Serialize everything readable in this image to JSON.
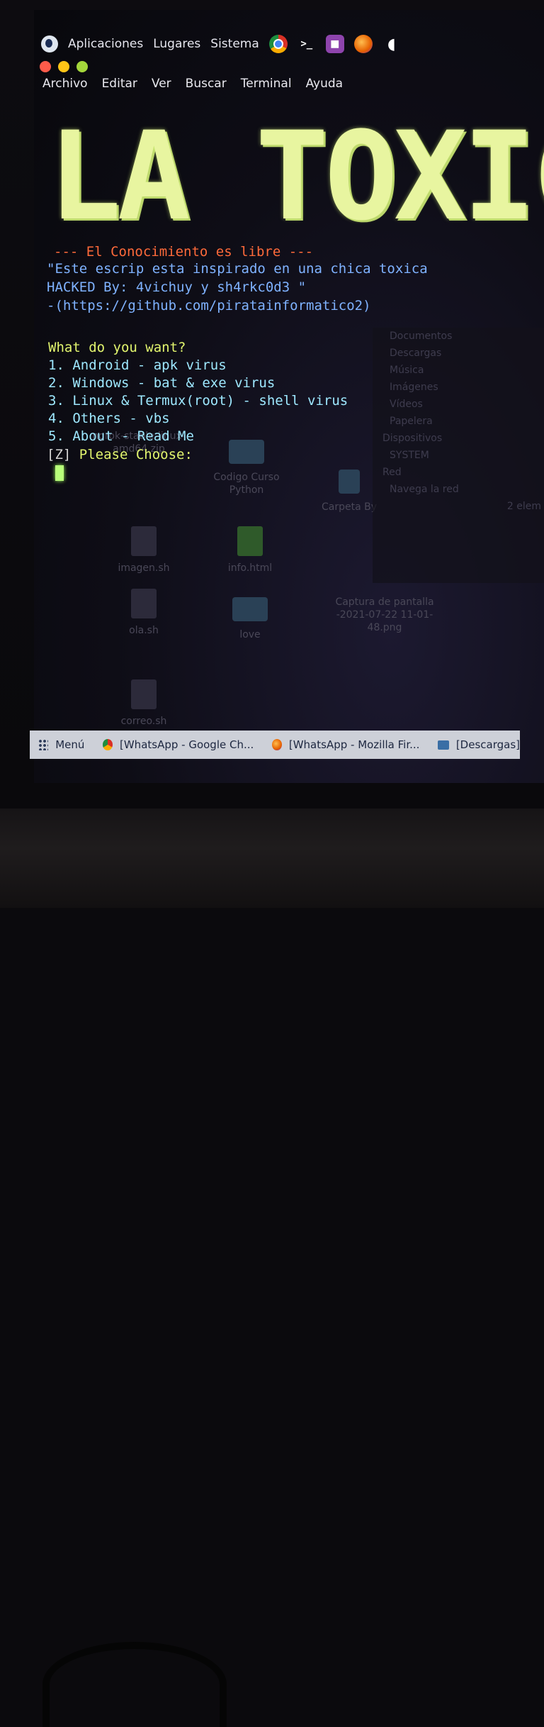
{
  "top_panel": {
    "applications": "Aplicaciones",
    "places": "Lugares",
    "system": "Sistema",
    "launchers": [
      "chrome-icon",
      "terminal-icon",
      "purple-app-icon",
      "firefox-icon",
      "moon-icon"
    ],
    "terminal_glyph": ">_"
  },
  "window_controls": {
    "close_color": "#ff5b4a",
    "minimize_color": "#ffc517",
    "maximize_color": "#a4d63b"
  },
  "menubar": {
    "items": [
      "Archivo",
      "Editar",
      "Ver",
      "Buscar",
      "Terminal",
      "Ayuda"
    ]
  },
  "terminal": {
    "banner": "LA TOXICA",
    "tagline": "--- El Conocimiento es libre ---",
    "quote_line1": "\"Este escrip esta inspirado en una chica toxica",
    "quote_line2": " HACKED By: 4vichuy y sh4rkc0d3 \"",
    "url_line": " -(https://github.com/piratainformatico2)",
    "question": "What do you want?",
    "options": [
      " 1. Android - apk virus",
      " 2. Windows - bat & exe virus",
      " 3. Linux & Termux(root) - shell virus",
      " 4. Others - vbs",
      " 5. About - Read Me"
    ],
    "prompt_marker": " [Z]",
    "prompt_text": " Please Choose:",
    "colors": {
      "banner": "#e8f5a0",
      "tagline": "#ff6a3a",
      "quote": "#7fb2ff",
      "menu": "#e2f56e",
      "options": "#9ee8ff",
      "cursor": "#b8ff7a"
    }
  },
  "desktop_behind": {
    "files": [
      "ngrok-stable-linux-amd64.zip",
      "Codigo Curso Python",
      "Carpeta By",
      "imagen.sh",
      "info.html",
      "ola.sh",
      "love",
      "Captura de pantalla -2021-07-22 11-01-48.png",
      "correo.sh"
    ],
    "sidebar": [
      "Documentos",
      "Descargas",
      "Música",
      "Imágenes",
      "Vídeos",
      "Papelera",
      "Dispositivos",
      "SYSTEM",
      "Red",
      "Navega la red"
    ],
    "status": "2 elem"
  },
  "taskbar": {
    "menu": "Menú",
    "tasks": [
      "[WhatsApp - Google Ch...",
      "[WhatsApp - Mozilla Fir...",
      "[Descargas]"
    ]
  }
}
